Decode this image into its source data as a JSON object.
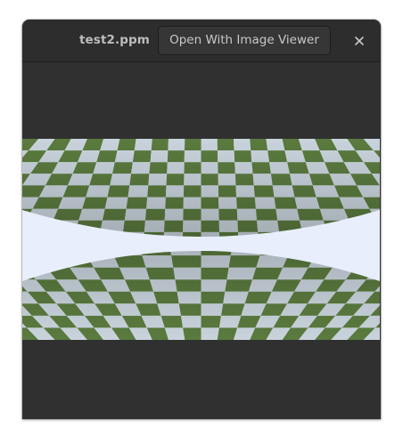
{
  "window": {
    "title": "test2.ppm",
    "open_with_label": "Open With Image Viewer",
    "close_icon": "close-icon"
  },
  "image": {
    "description_icon": "rendered-image-checkerboard-spheres",
    "colors": {
      "background": "#e8eefc",
      "check_dark": "#5a7a3e",
      "check_light": "#c9d3dc",
      "window": "#303030",
      "titlebar": "#2d2d2d"
    }
  }
}
